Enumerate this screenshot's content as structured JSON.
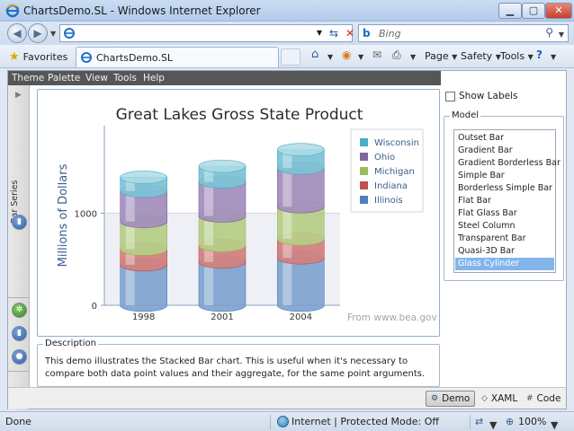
{
  "window": {
    "title": "ChartsDemo.SL - Windows Internet Explorer"
  },
  "search": {
    "placeholder": "Bing"
  },
  "favorites": {
    "label": "Favorites"
  },
  "tab": {
    "label": "ChartsDemo.SL"
  },
  "commands": {
    "page": "Page",
    "safety": "Safety",
    "tools": "Tools"
  },
  "menu": [
    "Theme",
    "Palette",
    "View",
    "Tools",
    "Help"
  ],
  "sidebar": {
    "label": "Bar Series"
  },
  "show_labels": {
    "label": "Show Labels",
    "checked": false
  },
  "model": {
    "title": "Model",
    "items": [
      "Outset Bar",
      "Gradient Bar",
      "Gradient Borderless Bar",
      "Simple Bar",
      "Borderless Simple Bar",
      "Flat Bar",
      "Flat Glass Bar",
      "Steel Column",
      "Transparent Bar",
      "Quasi-3D Bar",
      "Glass Cylinder"
    ],
    "selected": "Glass Cylinder"
  },
  "chart_data": {
    "type": "bar",
    "stacked": true,
    "title": "Great Lakes Gross State Product",
    "ylabel": "Millions of Dollars",
    "xlabel": "",
    "categories": [
      "1998",
      "2001",
      "2004"
    ],
    "yticks": [
      "0",
      "1000"
    ],
    "ylim": [
      0,
      1950
    ],
    "series": [
      {
        "name": "Illinois",
        "color": "#4f81bd",
        "values": [
          440,
          470,
          515
        ]
      },
      {
        "name": "Indiana",
        "color": "#c0504d",
        "values": [
          170,
          180,
          205
        ]
      },
      {
        "name": "Michigan",
        "color": "#9bbb59",
        "values": [
          300,
          320,
          350
        ]
      },
      {
        "name": "Ohio",
        "color": "#8064a2",
        "values": [
          330,
          370,
          420
        ]
      },
      {
        "name": "Wisconsin",
        "color": "#4bacc6",
        "values": [
          150,
          170,
          200
        ]
      }
    ],
    "legend_order": [
      "Wisconsin",
      "Ohio",
      "Michigan",
      "Indiana",
      "Illinois"
    ],
    "legend_position": "right",
    "note": "From www.bea.gov"
  },
  "description": {
    "title": "Description",
    "text": "This demo illustrates the Stacked Bar chart. This is useful when it's necessary to compare both data point values and their aggregate, for the same point arguments."
  },
  "bottom_tabs": [
    "Demo",
    "XAML",
    "Code"
  ],
  "status": {
    "left": "Done",
    "zone": "Internet | Protected Mode: Off",
    "zoom": "100%"
  }
}
